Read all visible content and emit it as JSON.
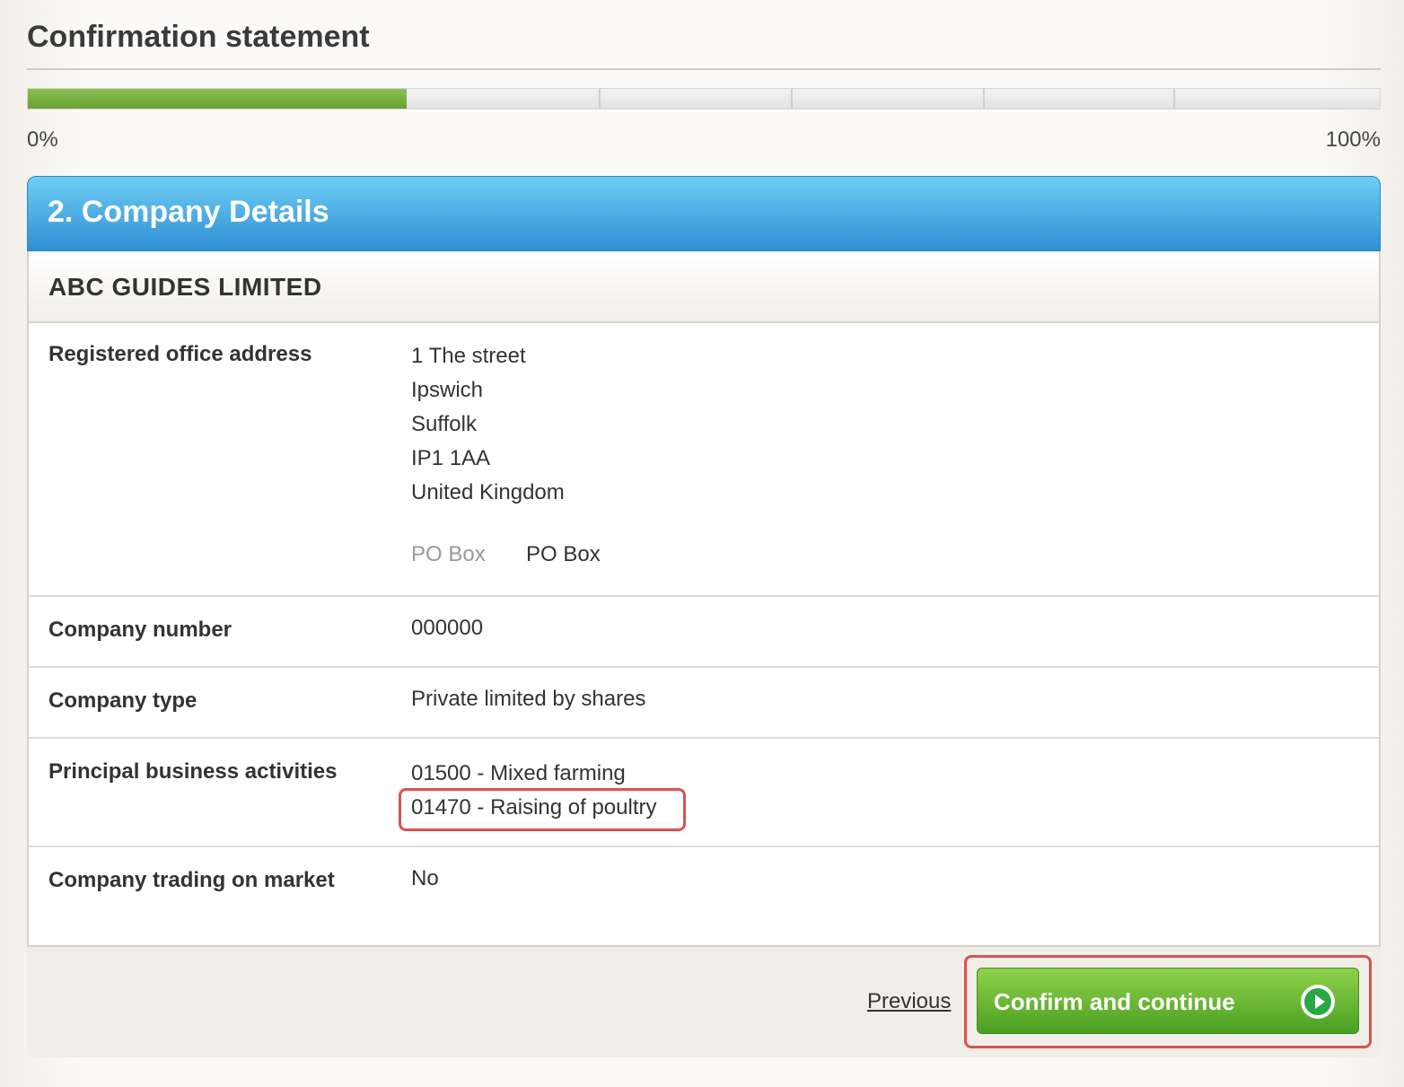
{
  "page": {
    "title": "Confirmation statement"
  },
  "progress": {
    "value_percent": 28,
    "start_label": "0%",
    "end_label": "100%",
    "fill_color": "#7ab740"
  },
  "section": {
    "title": "2. Company Details",
    "header_color": "#3fa6e4"
  },
  "company": {
    "name": "ABC GUIDES LIMITED"
  },
  "details": {
    "registered_office": {
      "label": "Registered office address",
      "lines": [
        "1 The street",
        "Ipswich",
        "Suffolk",
        "IP1 1AA",
        "United Kingdom"
      ],
      "po_box_label": "PO Box",
      "po_box_value": "PO Box"
    },
    "company_number": {
      "label": "Company number",
      "value": "000000"
    },
    "company_type": {
      "label": "Company type",
      "value": "Private limited by shares"
    },
    "principal_activities": {
      "label": "Principal business activities",
      "items": [
        "01500 - Mixed farming",
        "01470 - Raising of poultry"
      ]
    },
    "trading_on_market": {
      "label": "Company trading on market",
      "value": "No"
    }
  },
  "actions": {
    "previous_label": "Previous",
    "confirm_label": "Confirm and continue",
    "confirm_icon": "arrow-right-circle-icon",
    "confirm_color": "#5cb030"
  },
  "highlight_color": "#d9534f"
}
